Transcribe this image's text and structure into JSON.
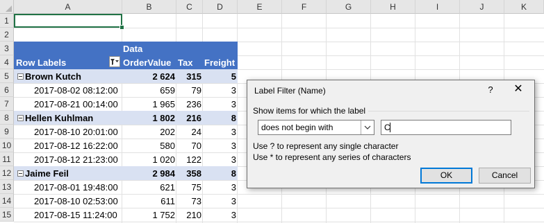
{
  "sheet": {
    "columns": [
      "A",
      "B",
      "C",
      "D",
      "E",
      "F",
      "G",
      "H",
      "I",
      "J",
      "K"
    ],
    "rows": [
      "1",
      "2",
      "3",
      "4",
      "5",
      "6",
      "7",
      "8",
      "9",
      "10",
      "11",
      "12",
      "13",
      "14",
      "15"
    ]
  },
  "pivot": {
    "data_caption": "Data",
    "row_labels": "Row Labels",
    "col_ordervalue": "OrderValue",
    "col_tax": "Tax",
    "col_freight": "Freight",
    "groups": [
      {
        "name": "Brown Kutch",
        "ordervalue": "2 624",
        "tax": "315",
        "freight": "5",
        "items": [
          {
            "label": "2017-08-02 08:12:00",
            "ordervalue": "659",
            "tax": "79",
            "freight": "3"
          },
          {
            "label": "2017-08-21 00:14:00",
            "ordervalue": "1 965",
            "tax": "236",
            "freight": "3"
          }
        ]
      },
      {
        "name": "Hellen Kuhlman",
        "ordervalue": "1 802",
        "tax": "216",
        "freight": "8",
        "items": [
          {
            "label": "2017-08-10 20:01:00",
            "ordervalue": "202",
            "tax": "24",
            "freight": "3"
          },
          {
            "label": "2017-08-12 16:22:00",
            "ordervalue": "580",
            "tax": "70",
            "freight": "3"
          },
          {
            "label": "2017-08-12 21:23:00",
            "ordervalue": "1 020",
            "tax": "122",
            "freight": "3"
          }
        ]
      },
      {
        "name": "Jaime Feil",
        "ordervalue": "2 984",
        "tax": "358",
        "freight": "8",
        "items": [
          {
            "label": "2017-08-01 19:48:00",
            "ordervalue": "621",
            "tax": "75",
            "freight": "3"
          },
          {
            "label": "2017-08-10 02:53:00",
            "ordervalue": "611",
            "tax": "73",
            "freight": "3"
          },
          {
            "label": "2017-08-15 11:24:00",
            "ordervalue": "1 752",
            "tax": "210",
            "freight": "3"
          }
        ]
      }
    ]
  },
  "dialog": {
    "title": "Label Filter (Name)",
    "help": "?",
    "close": "✕",
    "group_label": "Show items for which the label",
    "operator": "does not begin with",
    "value": "C",
    "hint1": "Use ? to represent any single character",
    "hint2": "Use * to represent any series of characters",
    "ok": "OK",
    "cancel": "Cancel"
  },
  "colors": {
    "pivot_header": "#4472c4",
    "pivot_band": "#d9e1f2",
    "selection": "#217346",
    "default_button": "#0078d7"
  }
}
